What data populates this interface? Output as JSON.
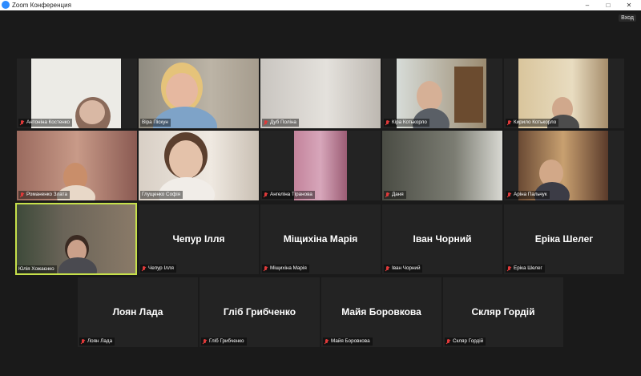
{
  "window": {
    "title": "Zoom Конференция",
    "controls": [
      "–",
      "□",
      "✕"
    ]
  },
  "toolbar": {
    "enter_label": "Вход"
  },
  "participants": [
    {
      "name": "Антоніна Костенко",
      "has_video": true,
      "muted": true
    },
    {
      "name": "Віра Піскун",
      "has_video": true,
      "muted": false
    },
    {
      "name": "Дуб Поліна",
      "has_video": true,
      "muted": true
    },
    {
      "name": "Кіра Котькорло",
      "has_video": true,
      "muted": true
    },
    {
      "name": "Кирило Котькорло",
      "has_video": true,
      "muted": true
    },
    {
      "name": "Романенко Злата",
      "has_video": true,
      "muted": true
    },
    {
      "name": "Глущенко Софія",
      "has_video": true,
      "muted": false
    },
    {
      "name": "Ангеліна Тіранова",
      "has_video": true,
      "muted": true
    },
    {
      "name": "Даня",
      "has_video": true,
      "muted": true
    },
    {
      "name": "Аріна Пальчук",
      "has_video": true,
      "muted": true
    },
    {
      "name": "Юлія Хожаєнко",
      "has_video": true,
      "muted": false,
      "active_speaker": true
    },
    {
      "name": "Чепур Ілля",
      "display_name": "Чепур Ілля",
      "has_video": false,
      "muted": true
    },
    {
      "name": "Міщихіна Марія",
      "display_name": "Міщихіна Марія",
      "has_video": false,
      "muted": true
    },
    {
      "name": "Іван Чорний",
      "display_name": "Іван Чорний",
      "has_video": false,
      "muted": true
    },
    {
      "name": "Еріка Шелег",
      "display_name": "Еріка Шелег",
      "has_video": false,
      "muted": true
    },
    {
      "name": "Лоян Лада",
      "display_name": "Лоян Лада",
      "has_video": false,
      "muted": true
    },
    {
      "name": "Гліб Грибченко",
      "display_name": "Гліб Грибченко",
      "has_video": false,
      "muted": true
    },
    {
      "name": "Майя Боровкова",
      "display_name": "Майя Боровкова",
      "has_video": false,
      "muted": true
    },
    {
      "name": "Скляр Гордій",
      "display_name": "Скляр Гордій",
      "has_video": false,
      "muted": true
    }
  ],
  "colors": {
    "background": "#1a1a1a",
    "tile": "#232323",
    "active_border": "#c6e04a",
    "muted_icon": "#e03a3a"
  }
}
